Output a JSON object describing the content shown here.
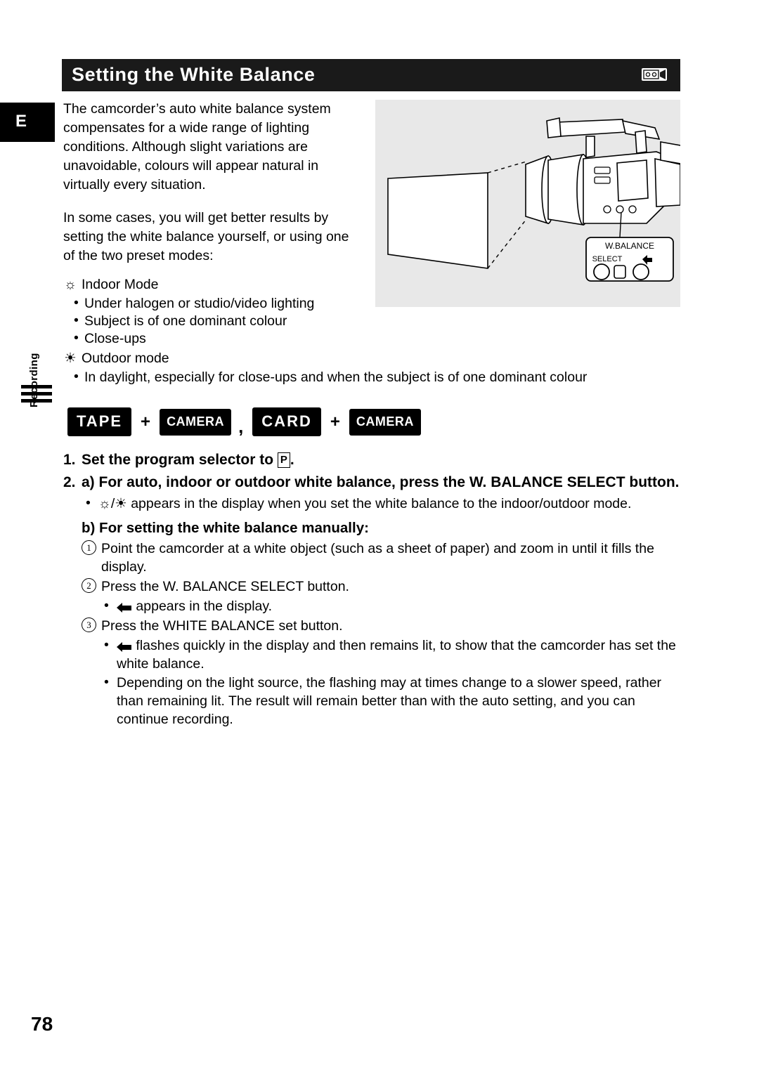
{
  "page": {
    "number": "78",
    "side_label": "Recording",
    "edge_tab": "E"
  },
  "header": {
    "title": "Setting the White Balance",
    "icon": "camcorder-tape-icon"
  },
  "intro": {
    "paragraph1": "The camcorder’s auto white balance system compensates for a wide range of lighting conditions. Although slight variations are unavoidable, colours will appear natural in virtually every situation.",
    "paragraph2": "In some cases, you will get better results by setting the white balance yourself, or using one of the two preset modes:"
  },
  "illustration": {
    "panel_label_line1": "W.BALANCE",
    "panel_label_line2": "SELECT",
    "alt": "camcorder pointing at a white card with W.BALANCE SELECT control callout"
  },
  "modes": {
    "indoor": {
      "symbol": "☼",
      "title": "Indoor Mode",
      "bullets": [
        "Under halogen or studio/video lighting",
        "Subject is of one dominant colour",
        "Close-ups"
      ]
    },
    "outdoor": {
      "symbol": "☀",
      "title": "Outdoor mode",
      "bullets": [
        "In daylight, especially for close-ups and  when the subject is of one dominant colour"
      ]
    }
  },
  "badges": {
    "tape": "TAPE",
    "plus1": "+",
    "camera1": "CAMERA",
    "separator": ",",
    "card": "CARD",
    "plus2": "+",
    "camera2": "CAMERA"
  },
  "steps": {
    "step1": {
      "number": "1.",
      "text_before": "Set the program selector to ",
      "program_symbol": "P",
      "text_after": "."
    },
    "step2": {
      "number": "2.",
      "a_text": "a) For auto, indoor or outdoor white balance, press the W. BALANCE SELECT button.",
      "a_bullet_before": " appears in the display when you set the white balance to the indoor/outdoor mode.",
      "a_bullet_symbols": "☼/☀",
      "b_text": "b) For setting the white balance manually:",
      "b_items": [
        {
          "marker": "1",
          "text": "Point the camcorder at a white object (such as a sheet of paper) and zoom in until it fills the display."
        },
        {
          "marker": "2",
          "text": "Press the W. BALANCE SELECT button."
        },
        {
          "marker": "3",
          "text": "Press the WHITE BALANCE  set button."
        }
      ],
      "b_bullet_after_2": " appears in the display.",
      "b_bullet_after_3": " flashes quickly in the display and then remains lit, to show that the camcorder has set the white balance.",
      "b_bullet_final": "Depending on the light source, the flashing may at times change to a slower speed, rather than remaining lit. The result will remain better than with the auto setting, and you can continue recording."
    }
  }
}
